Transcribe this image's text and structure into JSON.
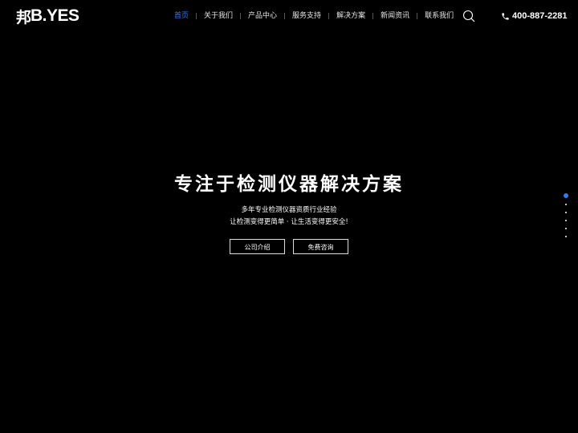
{
  "header": {
    "logo_mark": "邦",
    "logo_text": "B.YES",
    "nav": [
      {
        "label": "首页",
        "active": true
      },
      {
        "label": "关于我们"
      },
      {
        "label": "产品中心"
      },
      {
        "label": "服务支持"
      },
      {
        "label": "解决方案"
      },
      {
        "label": "新闻资讯"
      },
      {
        "label": "联系我们"
      }
    ],
    "search_icon": "search-icon",
    "phone_icon": "phone-icon",
    "phone": "400-887-2281"
  },
  "hero": {
    "title": "专注于检测仪器解决方案",
    "subtitle_line1": "多年专业检测仪器资质行业经验",
    "subtitle_line2": "让检测变得更简单 · 让生活变得更安全!",
    "button_about": "公司介绍",
    "button_consult": "免费咨询"
  },
  "pager": {
    "count": 6,
    "active_index": 0
  },
  "colors": {
    "background": "#000000",
    "accent": "#2f7cf6",
    "text": "#ffffff"
  }
}
